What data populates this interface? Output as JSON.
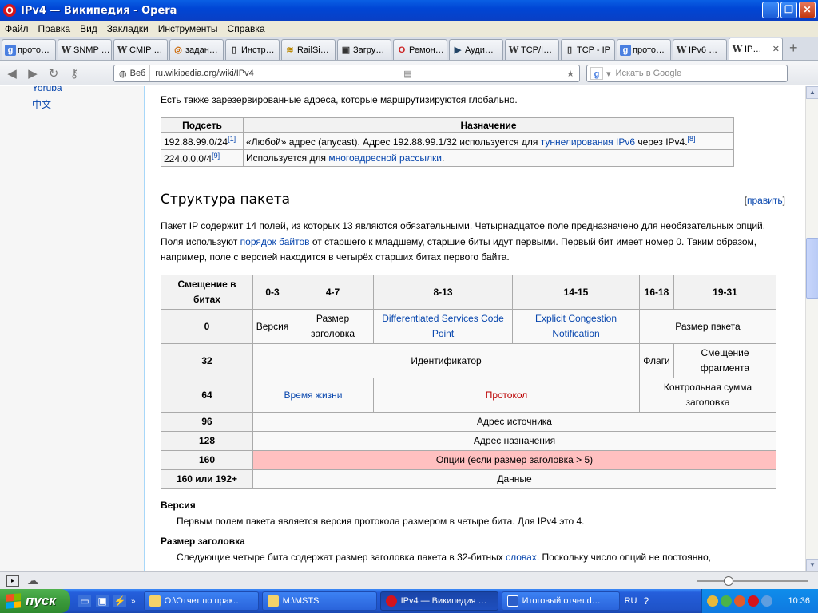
{
  "window": {
    "title": "IPv4 — Википедия - Opera"
  },
  "menu": [
    "Файл",
    "Правка",
    "Вид",
    "Закладки",
    "Инструменты",
    "Справка"
  ],
  "tabs": [
    {
      "label": "прото…",
      "icon": "g"
    },
    {
      "label": "SNMP …",
      "icon": "W"
    },
    {
      "label": "CMIP …",
      "icon": "W"
    },
    {
      "label": "задан…",
      "icon": "o"
    },
    {
      "label": "Инстр…",
      "icon": "doc"
    },
    {
      "label": "RailSi…",
      "icon": "rail"
    },
    {
      "label": "Загру…",
      "icon": "lock"
    },
    {
      "label": "Ремон…",
      "icon": "opera"
    },
    {
      "label": "Ауди…",
      "icon": "play"
    },
    {
      "label": "TCP/I…",
      "icon": "W"
    },
    {
      "label": "TCP - IP",
      "icon": "doc"
    },
    {
      "label": "прото…",
      "icon": "g"
    },
    {
      "label": "IPv6 …",
      "icon": "W"
    },
    {
      "label": "IP…",
      "icon": "W",
      "active": true
    }
  ],
  "address": {
    "web_label": "Веб",
    "url": "ru.wikipedia.org/wiki/IPv4",
    "search_placeholder": "Искать в Google"
  },
  "sidebar": {
    "links": [
      "Yoruba",
      "中文"
    ]
  },
  "article": {
    "intro": "Есть также зарезервированные адреса, которые маршрутизируются глобально.",
    "reserved_table": {
      "headers": [
        "Подсеть",
        "Назначение"
      ],
      "row1": {
        "subnet": "192.88.99.0/24",
        "ref": "[1]",
        "t1": "«Любой» адрес (anycast). Адрес 192.88.99.1/32 используется для ",
        "link1": "туннелирования",
        "t2": " ",
        "link2": "IPv6",
        "t3": " через IPv4.",
        "ref2": "[8]"
      },
      "row2": {
        "subnet": "224.0.0.0/4",
        "ref": "[9]",
        "t1": "Используется для ",
        "link1": "многоадресной рассылки",
        "t2": "."
      }
    },
    "section_title": "Структура пакета",
    "edit": {
      "open": "[",
      "label": "править",
      "close": "]"
    },
    "para": {
      "t1": "Пакет IP содержит 14 полей, из которых 13 являются обязательными. Четырнадцатое поле предназначено для необязательных опций. Поля используют ",
      "link": "порядок байтов",
      "t2": " от старшего к младшему, старшие биты идут первыми. Первый бит имеет номер 0. Таким образом, например, поле с версией находится в четырёх старших битах первого байта."
    },
    "packet_table": {
      "headers": [
        "Смещение в битах",
        "0-3",
        "4-7",
        "8-13",
        "14-15",
        "16-18",
        "19-31"
      ],
      "offsets": [
        "0",
        "32",
        "64",
        "96",
        "128",
        "160",
        "160 или 192+"
      ],
      "version": "Версия",
      "hlen": "Размер заголовка",
      "dscp": "Differentiated Services Code Point",
      "ecn": "Explicit Congestion Notification",
      "total_len": "Размер пакета",
      "ident": "Идентификатор",
      "flags": "Флаги",
      "frag": "Смещение фрагмента",
      "ttl": "Время жизни",
      "proto": "Протокол",
      "checksum": "Контрольная сумма заголовка",
      "src": "Адрес источника",
      "dst": "Адрес назначения",
      "options": "Опции (если размер заголовка > 5)",
      "data": "Данные"
    },
    "version_term": "Версия",
    "version_desc": "Первым полем пакета является версия протокола размером в четыре бита. Для IPv4 это 4.",
    "hlen_term": "Размер заголовка",
    "hlen_desc1": "Следующие четыре бита содержат размер заголовка пакета в 32-битных ",
    "hlen_link": "словах",
    "hlen_desc2": ". Поскольку число опций не постоянно,"
  },
  "taskbar": {
    "start": "пуск",
    "tasks": [
      {
        "label": "O:\\Отчет по прак…",
        "icon": "folder"
      },
      {
        "label": "M:\\MSTS",
        "icon": "folder"
      },
      {
        "label": "IPv4 — Википедия …",
        "icon": "opera",
        "active": true
      },
      {
        "label": "Итоговый отчет.d…",
        "icon": "word"
      }
    ],
    "lang": "RU",
    "clock": "10:36"
  },
  "colors": {
    "link": "#0645ad",
    "redlink": "#ba0000",
    "options_bg": "#ffc0c0",
    "taskbar": "#245edb"
  }
}
